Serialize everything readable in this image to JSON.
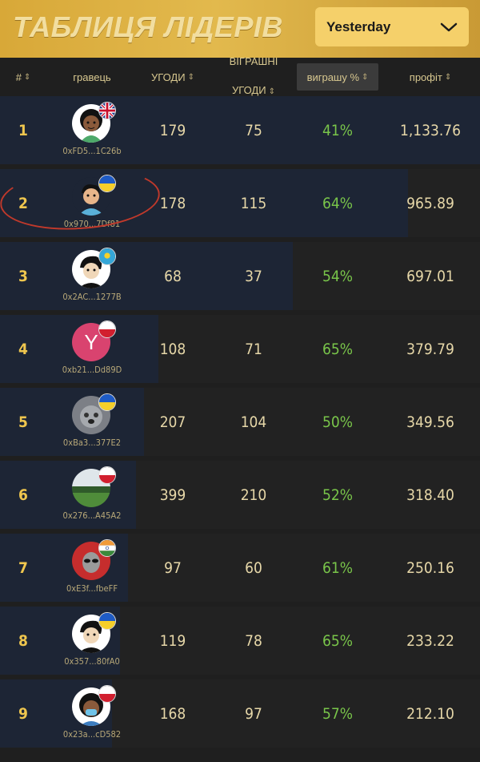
{
  "header": {
    "title": "ТАБЛИЦЯ ЛІДЕРІВ",
    "period": "Yesterday"
  },
  "columns": {
    "rank": "#",
    "player": "гравець",
    "deals": "УГОДИ",
    "wins_line1": "ВІГРАШНІ",
    "wins_line2": "УГОДИ",
    "winrate": "виграшу %",
    "profit": "профіт"
  },
  "rows": [
    {
      "rank": "1",
      "address": "0xFD5...1C26b",
      "deals": "179",
      "wins": "75",
      "winrate": "41%",
      "profit": "1,133.76",
      "flag": "uk-flag",
      "avatar": "cartoon-woman-avatar"
    },
    {
      "rank": "2",
      "address": "0x970...7Df81",
      "deals": "178",
      "wins": "115",
      "winrate": "64%",
      "profit": "965.89",
      "flag": "ukraine-flag",
      "avatar": "cartoon-boy-avatar"
    },
    {
      "rank": "3",
      "address": "0x2AC...1277B",
      "deals": "68",
      "wins": "37",
      "winrate": "54%",
      "profit": "697.01",
      "flag": "kazakhstan-flag",
      "avatar": "cartoon-man-avatar"
    },
    {
      "rank": "4",
      "address": "0xb21...Dd89D",
      "deals": "108",
      "wins": "71",
      "winrate": "65%",
      "profit": "379.79",
      "flag": "poland-flag",
      "avatar": "letter-avatar",
      "avatar_letter": "Y"
    },
    {
      "rank": "5",
      "address": "0xBa3...377E2",
      "deals": "207",
      "wins": "104",
      "winrate": "50%",
      "profit": "349.56",
      "flag": "ukraine-flag",
      "avatar": "photo-avatar"
    },
    {
      "rank": "6",
      "address": "0x276...A45A2",
      "deals": "399",
      "wins": "210",
      "winrate": "52%",
      "profit": "318.40",
      "flag": "poland-flag",
      "avatar": "landscape-avatar"
    },
    {
      "rank": "7",
      "address": "0xE3f...fbeFF",
      "deals": "97",
      "wins": "60",
      "winrate": "61%",
      "profit": "250.16",
      "flag": "india-flag",
      "avatar": "alien-avatar"
    },
    {
      "rank": "8",
      "address": "0x357...80fA0",
      "deals": "119",
      "wins": "78",
      "winrate": "65%",
      "profit": "233.22",
      "flag": "ukraine-flag",
      "avatar": "cartoon-man-avatar"
    },
    {
      "rank": "9",
      "address": "0x23a...cD582",
      "deals": "168",
      "wins": "97",
      "winrate": "57%",
      "profit": "212.10",
      "flag": "poland-flag",
      "avatar": "cartoon-woman-mask-avatar"
    }
  ],
  "colors": {
    "accent": "#efc64e",
    "winrate_green": "#79c54a",
    "row_highlight": "#1d2535",
    "row_bg": "#222222",
    "annotation_red": "#c0392b"
  }
}
